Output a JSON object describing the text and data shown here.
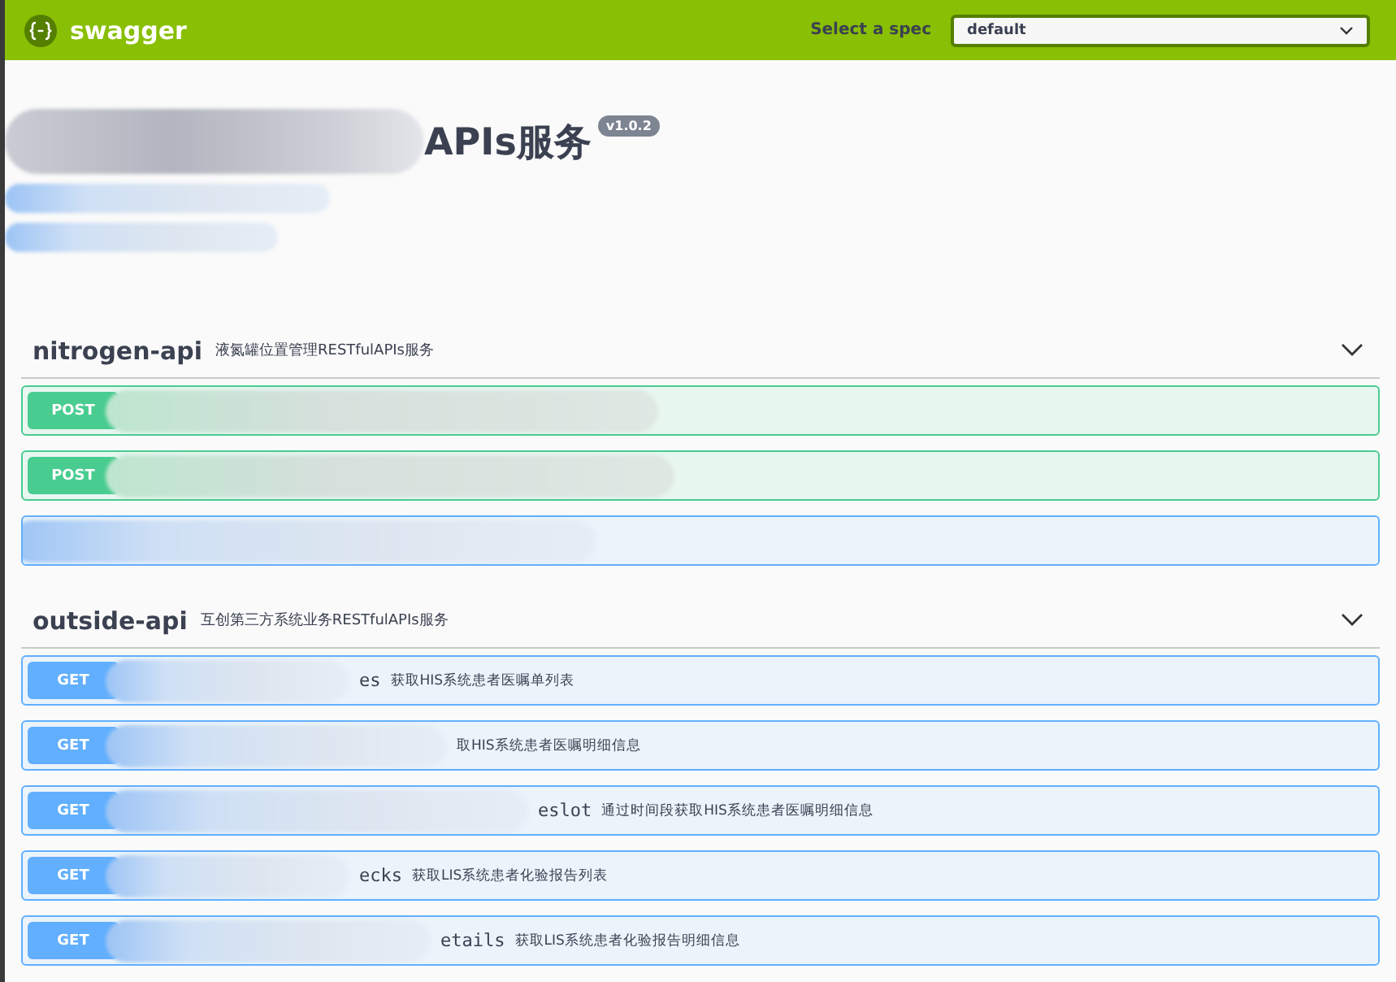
{
  "topbar": {
    "brand": "swagger",
    "spec_label": "Select a spec",
    "spec_value": "default"
  },
  "info": {
    "title": "APIs服务",
    "version": "v1.0.2"
  },
  "tags": [
    {
      "name": "nitrogen-api",
      "description": "液氮罐位置管理RESTfulAPIs服务",
      "expanded": true,
      "operations": [
        {
          "kind": "post",
          "method": "POST"
        },
        {
          "kind": "post",
          "method": "POST"
        },
        {
          "kind": "get"
        }
      ]
    },
    {
      "name": "outside-api",
      "description": "互创第三方系统业务RESTfulAPIs服务",
      "expanded": true,
      "operations": [
        {
          "kind": "get",
          "method": "GET",
          "path": "es",
          "summary": "获取HIS系统患者医嘱单列表"
        },
        {
          "kind": "get",
          "method": "GET",
          "summary": "取HIS系统患者医嘱明细信息"
        },
        {
          "kind": "get",
          "method": "GET",
          "path": "eslot",
          "summary": "通过时间段获取HIS系统患者医嘱明细信息"
        },
        {
          "kind": "get",
          "method": "GET",
          "path": "ecks",
          "summary": "获取LIS系统患者化验报告列表"
        },
        {
          "kind": "get",
          "method": "GET",
          "path": "etails",
          "summary": "获取LIS系统患者化验报告明细信息"
        }
      ]
    }
  ]
}
